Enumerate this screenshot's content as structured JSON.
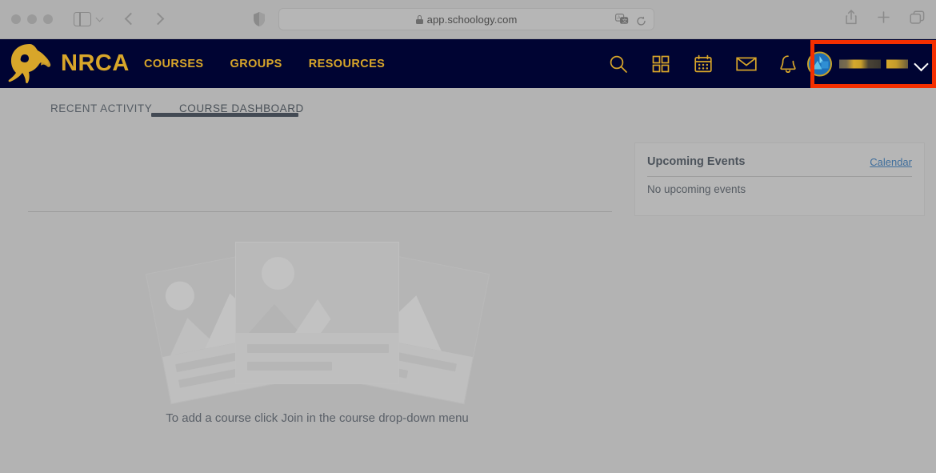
{
  "browser": {
    "url": "app.schoology.com",
    "lock_icon": "lock-icon",
    "back_label": "Back",
    "forward_label": "Forward",
    "sidebar_label": "Show Sidebar",
    "shield_label": "Privacy Report",
    "translate_label": "Translate",
    "reload_label": "Reload",
    "share_label": "Share",
    "newtab_label": "New Tab",
    "tabs_label": "Tab Overview"
  },
  "header": {
    "logo_text": "NRCA",
    "logo_icon": "spartan-helmet-icon",
    "nav": [
      {
        "label": "COURSES"
      },
      {
        "label": "GROUPS"
      },
      {
        "label": "RESOURCES"
      }
    ],
    "icons": [
      {
        "name": "search-icon"
      },
      {
        "name": "apps-grid-icon"
      },
      {
        "name": "calendar-icon"
      },
      {
        "name": "messages-envelope-icon"
      },
      {
        "name": "notifications-bell-icon"
      }
    ],
    "account": {
      "avatar_label": "User avatar",
      "name_redacted": true,
      "chevron": "chevron-down-icon"
    },
    "colors": {
      "navy": "#000433",
      "gold": "#d8a62a",
      "annotation_red": "#f42f00"
    }
  },
  "tabs": [
    {
      "label": "RECENT ACTIVITY",
      "active": false
    },
    {
      "label": "COURSE DASHBOARD",
      "active": true
    }
  ],
  "empty_state": {
    "message": "To add a course click Join in the course drop-down menu",
    "illustration": "placeholder-course-cards"
  },
  "events": {
    "title": "Upcoming Events",
    "link": "Calendar",
    "body": "No upcoming events"
  }
}
